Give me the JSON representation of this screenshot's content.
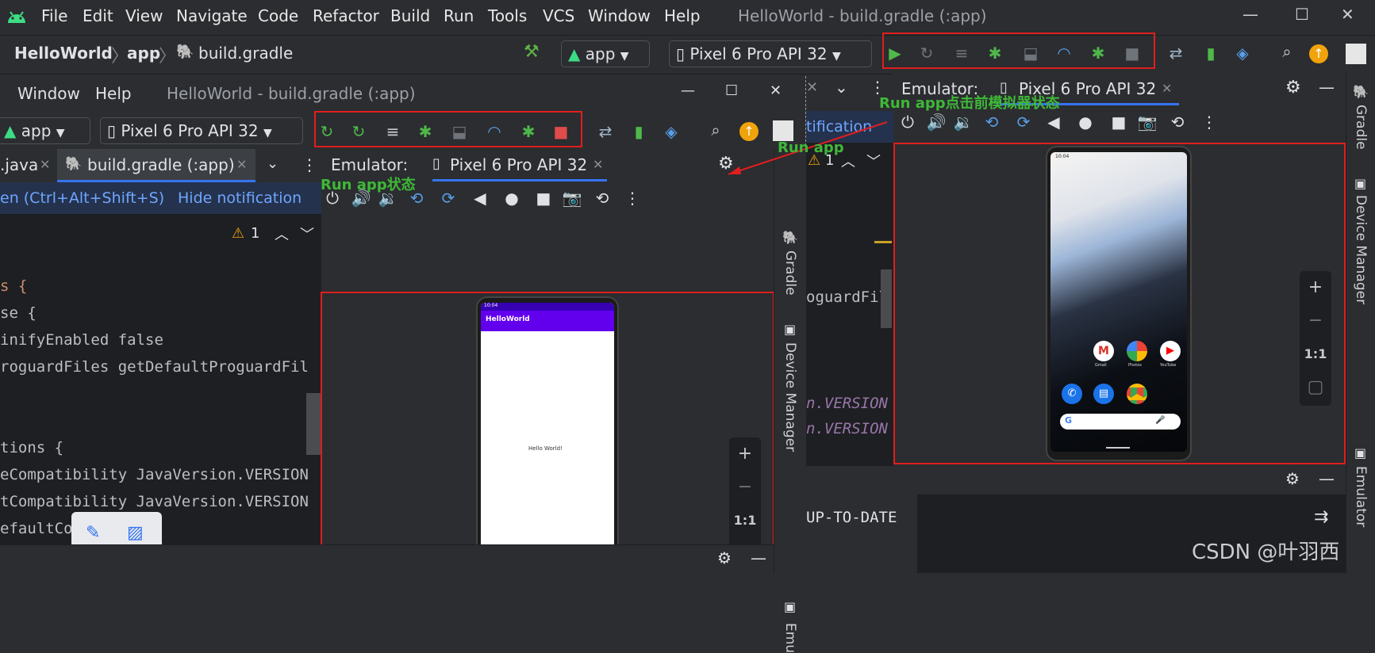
{
  "menu": {
    "items": [
      "File",
      "Edit",
      "View",
      "Navigate",
      "Code",
      "Refactor",
      "Build",
      "Run",
      "Tools",
      "VCS",
      "Window",
      "Help"
    ],
    "title": "HelloWorld - build.gradle (:app)"
  },
  "nav": {
    "project": "HelloWorld",
    "module": "app",
    "file": "build.gradle",
    "run_config": "app",
    "device": "Pixel 6 Pro API 32"
  },
  "win2": {
    "menu": [
      "Window",
      "Help"
    ],
    "title": "HelloWorld - build.gradle (:app)",
    "run_config": "app",
    "device": "Pixel 6 Pro API 32",
    "tabs": [
      ".java",
      "build.gradle (:app)"
    ],
    "notification": {
      "link1": "en (Ctrl+Alt+Shift+S)",
      "link2": "Hide notification"
    },
    "warning_count": "1",
    "emulator_label": "Emulator:",
    "emulator_tab": "Pixel 6 Pro API 32",
    "code": [
      "s {",
      "se {",
      "inifyEnabled false",
      "roguardFiles getDefaultProguardFil",
      "",
      "",
      "tions {",
      "eCompatibility JavaVersion.VERSION",
      "tCompatibility JavaVersion.VERSION",
      "efaultCon"
    ],
    "phone": {
      "time": "10:04",
      "app_title": "HelloWorld",
      "hello": "Hello World!"
    }
  },
  "right": {
    "emulator_label": "Emulator:",
    "emulator_tab": "Pixel 6 Pro API 32",
    "notification_link": "tification",
    "warning_count": "1",
    "code": [
      "oguardFil",
      "n.VERSION",
      "n.VERSION"
    ],
    "build_output": "UP-TO-DATE",
    "phone": {
      "time": "10:04",
      "apps": [
        "Gmail",
        "Photos",
        "YouTube"
      ]
    }
  },
  "zoom": {
    "in": "+",
    "out": "−",
    "ratio": "1:1"
  },
  "side_tabs": {
    "gradle": "Gradle",
    "device_manager": "Device Manager",
    "emulator": "Emulator",
    "emu": "Emu"
  },
  "annotations": {
    "run_app_before": "Run app点击前模拟器状态",
    "run_app": "Run app",
    "run_app_state": "Run app状态"
  },
  "watermark": "CSDN @叶羽西",
  "colors": {
    "accent_red": "#e01e1e",
    "annotation_green": "#3fb838",
    "app_bar": "#6200ee"
  }
}
